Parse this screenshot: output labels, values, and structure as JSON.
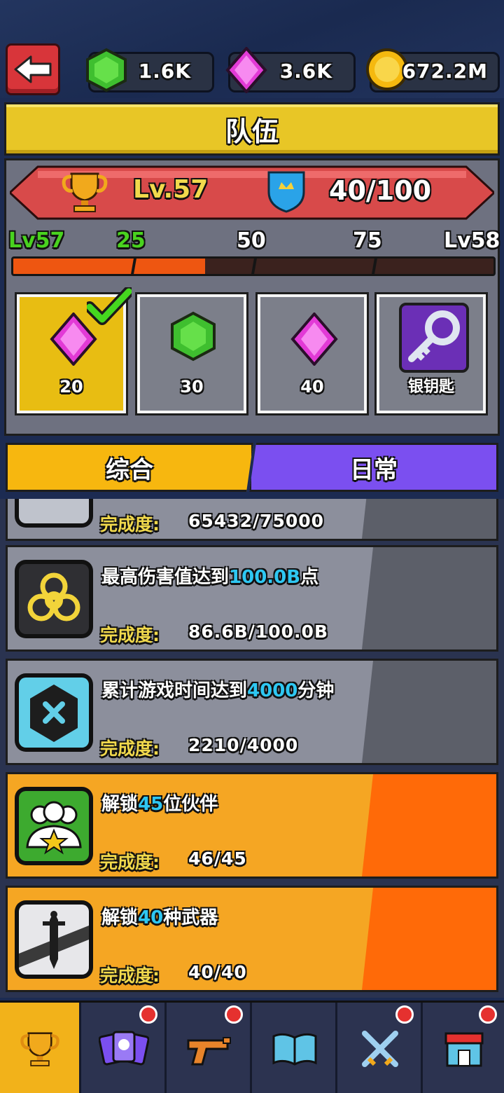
{
  "header": {
    "back_label": "back",
    "currencies": [
      {
        "name": "green-gem",
        "value": "1.6K"
      },
      {
        "name": "pink-gem",
        "value": "3.6K"
      },
      {
        "name": "gold-coin",
        "value": "672.2M"
      }
    ]
  },
  "title": "队伍",
  "team": {
    "level": "Lv.57",
    "points": "40/100",
    "progress_markers": [
      "Lv57",
      "25",
      "50",
      "75",
      "Lv58"
    ],
    "progress_fraction": 0.4
  },
  "rewards": [
    {
      "icon": "pink-gem-icon",
      "amount": "20",
      "claimed": true
    },
    {
      "icon": "green-gem-icon",
      "amount": "30",
      "claimed": false
    },
    {
      "icon": "pink-gem-icon",
      "amount": "40",
      "claimed": false
    },
    {
      "icon": "silver-key-icon",
      "amount": "银钥匙",
      "claimed": false
    }
  ],
  "tabs": [
    {
      "label": "综合",
      "active": true
    },
    {
      "label": "日常",
      "active": false
    }
  ],
  "progress_label": "完成度:",
  "tasks": [
    {
      "icon": "partial-icon",
      "desc_pre": "",
      "desc_hl": "",
      "desc_post": "",
      "progress": "65432/75000",
      "complete": false
    },
    {
      "icon": "biohazard-icon",
      "desc_pre": "最高伤害值达到",
      "desc_hl": "100.0B",
      "desc_post": "点",
      "progress": "86.6B/100.0B",
      "complete": false
    },
    {
      "icon": "crossed-clock-icon",
      "desc_pre": "累计游戏时间达到",
      "desc_hl": "4000",
      "desc_post": "分钟",
      "progress": "2210/4000",
      "complete": false
    },
    {
      "icon": "partners-icon",
      "desc_pre": "解锁",
      "desc_hl": "45",
      "desc_post": "位伙伴",
      "progress": "46/45",
      "complete": true
    },
    {
      "icon": "sword-icon",
      "desc_pre": "解锁",
      "desc_hl": "40",
      "desc_post": "种武器",
      "progress": "40/40",
      "complete": true
    }
  ],
  "bottom_nav": [
    {
      "icon": "trophy-icon",
      "active": true,
      "badge": false
    },
    {
      "icon": "cards-icon",
      "active": false,
      "badge": true
    },
    {
      "icon": "pistol-icon",
      "active": false,
      "badge": true
    },
    {
      "icon": "book-icon",
      "active": false,
      "badge": false
    },
    {
      "icon": "crossed-swords-icon",
      "active": false,
      "badge": true
    },
    {
      "icon": "shop-icon",
      "active": false,
      "badge": true
    }
  ],
  "colors": {
    "title_yellow": "#e8c626",
    "ribbon_red": "#d84a4a",
    "progress_orange": "#ee5611",
    "highlight_cyan": "#2ec7f2",
    "task_grey": "#8c8f9c",
    "task_orange": "#f5a623",
    "tab_active": "#f7b70f",
    "tab_inactive": "#7b4ff0"
  }
}
